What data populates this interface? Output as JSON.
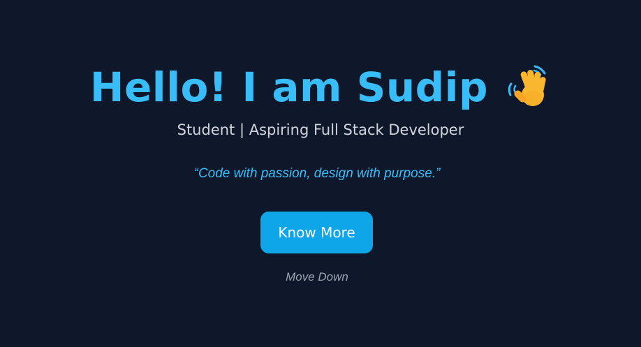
{
  "hero": {
    "title": "Hello! I am Sudip",
    "title_emoji": "waving-hand-icon",
    "subtitle": "Student | Aspiring Full Stack Developer",
    "quote": "“Code with passion, design with purpose.”",
    "cta_label": "Know More",
    "scroll_hint": "Move Down"
  },
  "colors": {
    "background": "#0f172a",
    "accent": "#38bdf8",
    "button": "#0ea5e9",
    "subtitle": "#d1d5db",
    "muted": "#9ca3af"
  }
}
